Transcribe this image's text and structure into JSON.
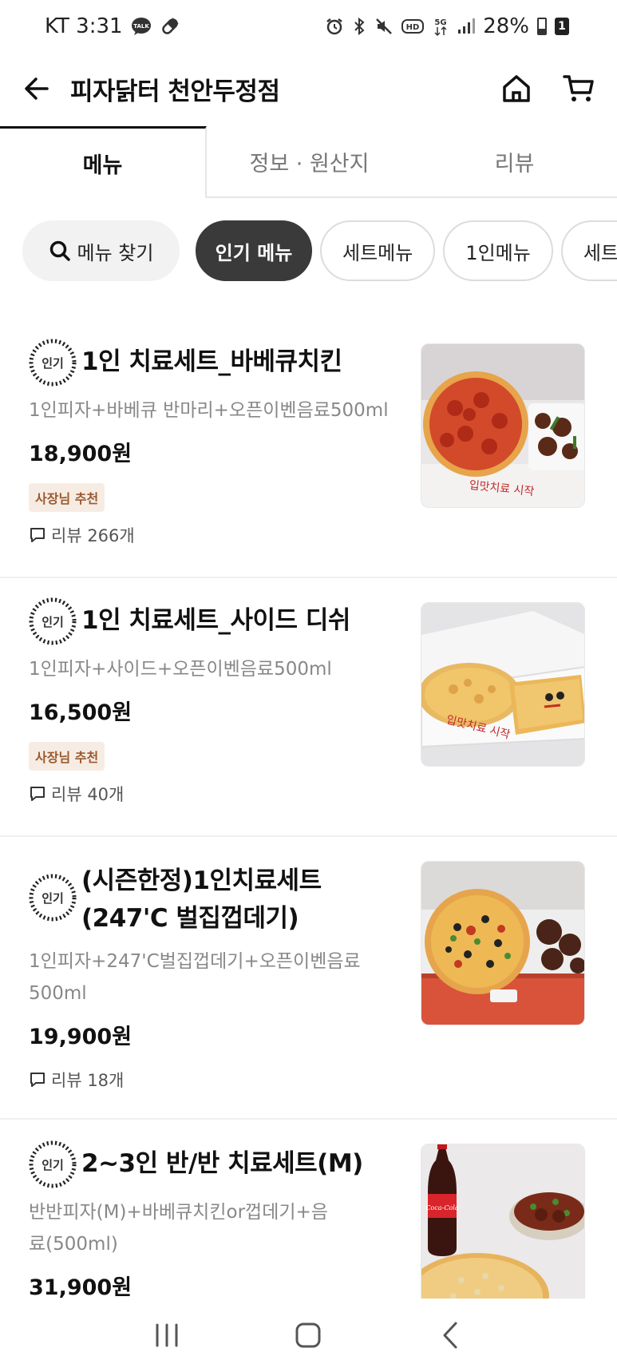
{
  "status_bar": {
    "carrier_time": "KT 3:31",
    "battery": "28%",
    "sim": "1",
    "icons": [
      "talk-icon",
      "pill-icon",
      "alarm-icon",
      "bluetooth-icon",
      "mute-icon",
      "hd-icon",
      "5g-icon",
      "signal-icon",
      "battery-icon"
    ]
  },
  "header": {
    "title": "피자닭터 천안두정점"
  },
  "tabs": [
    {
      "label": "메뉴",
      "active": true
    },
    {
      "label": "정보 · 원산지",
      "active": false
    },
    {
      "label": "리뷰",
      "active": false
    }
  ],
  "chips": {
    "search_label": "메뉴 찾기",
    "items": [
      "인기 메뉴",
      "세트메뉴",
      "1인메뉴",
      "세트메뉴"
    ]
  },
  "menu": {
    "popular_badge": "인기",
    "items": [
      {
        "name": "1인 치료세트_바베큐치킨",
        "desc": "1인피자+바베큐 반마리+오픈이벤음료500ml",
        "price": "18,900원",
        "owner_badge": "사장님 추천",
        "review": "리뷰 266개"
      },
      {
        "name": "1인 치료세트_사이드 디쉬",
        "desc": "1인피자+사이드+오픈이벤음료500ml",
        "price": "16,500원",
        "owner_badge": "사장님 추천",
        "review": "리뷰 40개"
      },
      {
        "name": "(시즌한정)1인치료세트(247'C 벌집껍데기)",
        "desc": "1인피자+247'C벌집껍데기+오픈이벤음료500ml",
        "price": "19,900원",
        "owner_badge": "",
        "review": "리뷰 18개"
      },
      {
        "name": "2~3인 반/반 치료세트(M)",
        "desc": "반반피자(M)+바베큐치킨or껍데기+음료(500ml)",
        "price": "31,900원",
        "owner_badge": "",
        "review": ""
      }
    ],
    "box_text": "입맛치료 시작",
    "cola_text": "Coca-Cola"
  },
  "colors": {
    "accent_dark": "#3a3a3a",
    "owner_badge_bg": "#f7ece3",
    "owner_badge_text": "#9a5a30"
  }
}
